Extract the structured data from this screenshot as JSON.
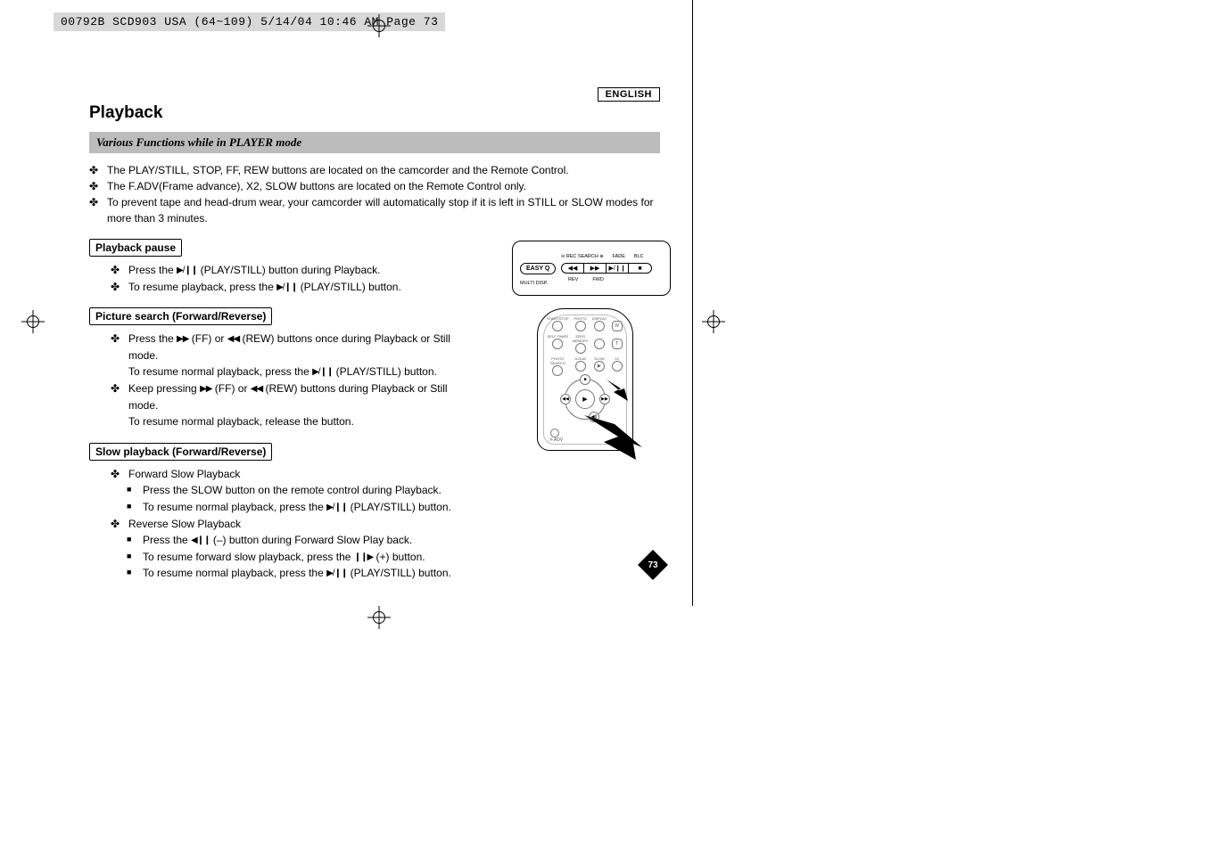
{
  "meta_header": "00792B SCD903 USA (64~109)  5/14/04 10:46 AM  Page 73",
  "language_label": "ENGLISH",
  "title": "Playback",
  "subtitle": "Various Functions while in PLAYER mode",
  "intro": [
    "The PLAY/STILL, STOP, FF, REW buttons are located on the camcorder and the Remote Control.",
    "The F.ADV(Frame advance), X2, SLOW buttons are located on the Remote Control only.",
    "To prevent tape and head-drum wear, your camcorder will automatically stop if it is left in STILL or SLOW modes for more than 3 minutes."
  ],
  "sections": {
    "pause": {
      "heading": "Playback pause",
      "items": [
        {
          "pre": "Press the ",
          "icon": "play-pause",
          "post": " (PLAY/STILL) button during Playback."
        },
        {
          "pre": "To resume playback, press the ",
          "icon": "play-pause",
          "post": " (PLAY/STILL) button."
        }
      ]
    },
    "search": {
      "heading": "Picture search (Forward/Reverse)",
      "items": [
        {
          "pre": "Press the ",
          "icon": "ff",
          "mid": " (FF) or ",
          "icon2": "rew",
          "post": " (REW) buttons once during Playback or Still mode.",
          "line2_pre": "To resume normal playback, press the ",
          "line2_icon": "play-pause",
          "line2_post": " (PLAY/STILL) button."
        },
        {
          "pre": "Keep pressing ",
          "icon": "ff",
          "mid": " (FF) or ",
          "icon2": "rew",
          "post": " (REW) buttons during Playback or Still mode.",
          "line2": "To resume normal playback, release the button."
        }
      ]
    },
    "slow": {
      "heading": "Slow playback (Forward/Reverse)",
      "items": [
        {
          "text": "Forward Slow Playback",
          "sub": [
            "Press the SLOW button on the remote control during Playback.",
            {
              "pre": "To resume normal playback, press the ",
              "icon": "play-pause",
              "post": " (PLAY/STILL) button."
            }
          ]
        },
        {
          "text": "Reverse Slow Playback",
          "sub": [
            {
              "pre": "Press the ",
              "icon": "rev-step",
              "post": " (–) button during Forward Slow Play back."
            },
            {
              "pre": "To resume forward slow playback, press the ",
              "icon": "fwd-step",
              "post": " (+) button."
            },
            {
              "pre": "To resume normal playback, press the ",
              "icon": "play-pause",
              "post": " (PLAY/STILL) button."
            }
          ]
        }
      ]
    }
  },
  "panel": {
    "easy": "EASY",
    "multi": "MULTI DISP.",
    "top_labels": [
      "REC SEARCH",
      "FADE",
      "BLC"
    ],
    "buttons": [
      "◀◀",
      "▶▶",
      "▶/❙❙",
      "■"
    ],
    "bottom_labels": [
      "REV",
      "FWD"
    ]
  },
  "remote": {
    "row_labels": [
      "START/STOP",
      "PHOTO",
      "DISPLAY",
      "",
      "SELF TIMER",
      "ZERO MEMORY",
      "",
      "W",
      "PHOTO SEARCH",
      "A.DUB",
      "SLOW",
      "T",
      "",
      "",
      "X2",
      ""
    ],
    "center": "▶",
    "fadv": "F.ADV"
  },
  "page_number": "73"
}
